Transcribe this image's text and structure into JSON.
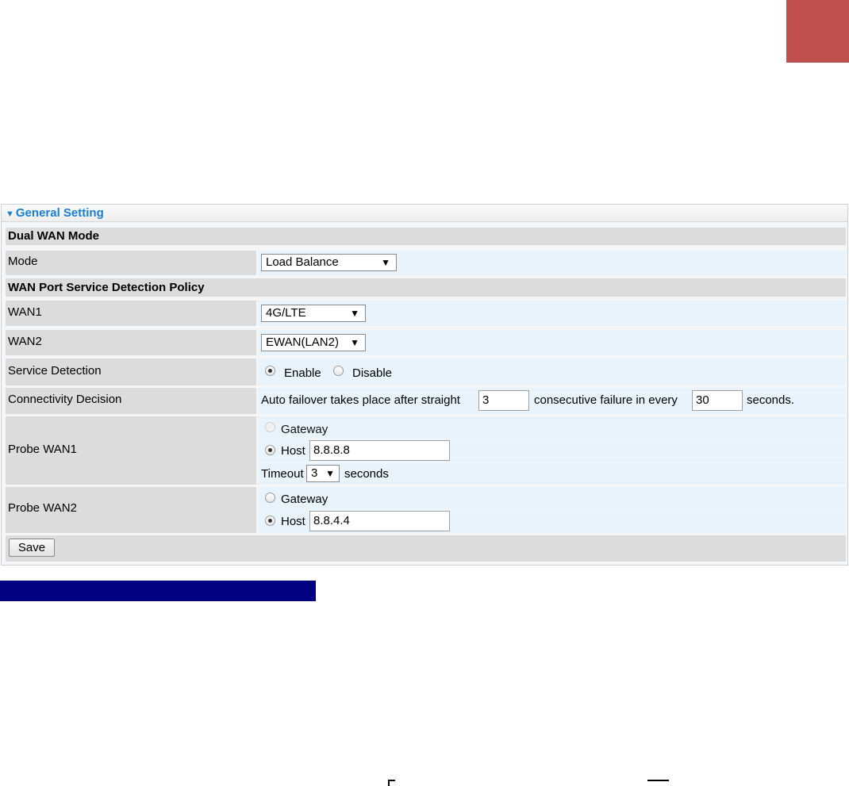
{
  "panel": {
    "title": "General Setting"
  },
  "dual_wan_section": {
    "heading": "Dual WAN Mode"
  },
  "mode": {
    "label": "Mode",
    "value": "Load Balance"
  },
  "detection_section": {
    "heading": "WAN Port Service Detection Policy"
  },
  "wan1": {
    "label": "WAN1",
    "value": "4G/LTE"
  },
  "wan2": {
    "label": "WAN2",
    "value": "EWAN(LAN2)"
  },
  "service_detection": {
    "label": "Service Detection",
    "enable": "Enable",
    "disable": "Disable",
    "selected": "Enable"
  },
  "connectivity": {
    "label": "Connectivity Decision",
    "text_before": "Auto failover takes place after straight",
    "failures": "3",
    "text_middle": "consecutive failure in every",
    "interval": "30",
    "text_after": "seconds."
  },
  "probe_wan1": {
    "label": "Probe WAN1",
    "gateway": "Gateway",
    "host_label": "Host",
    "host_value": "8.8.8.8",
    "timeout_label": "Timeout",
    "timeout_value": "3",
    "timeout_unit": "seconds"
  },
  "probe_wan2": {
    "label": "Probe WAN2",
    "gateway": "Gateway",
    "host_label": "Host",
    "host_value": "8.8.4.4"
  },
  "buttons": {
    "save": "Save"
  },
  "icons": {
    "collapse": "triangle-down-icon",
    "dropdown": "dropdown-arrow-icon"
  },
  "colors": {
    "accent": "#1a7fd0",
    "corner_block": "#c0504d",
    "navy_bar": "#000080",
    "label_bg": "#dcdcdc",
    "value_bg": "#e9f3fb"
  }
}
